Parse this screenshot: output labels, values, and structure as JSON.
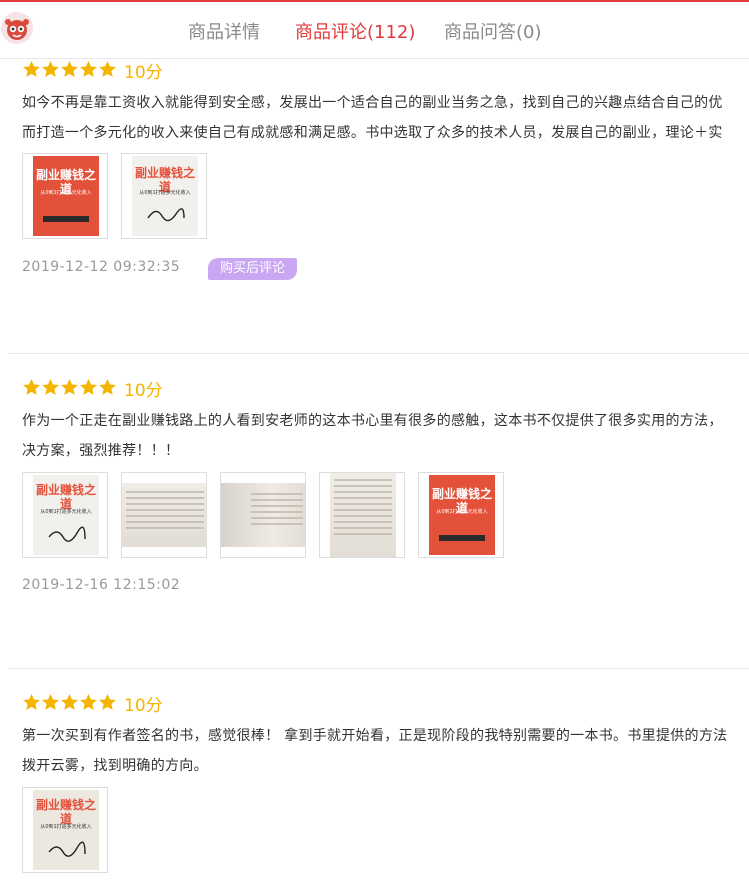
{
  "header": {
    "tabs": [
      {
        "label": "商品详情",
        "active": false
      },
      {
        "label": "商品评论(112)",
        "active": true
      },
      {
        "label": "商品问答(0)",
        "active": false
      }
    ],
    "accent_color": "#e23a3a"
  },
  "reviews": [
    {
      "rating_stars": 5,
      "score": "10分",
      "lines": [
        "如今不再是靠工资收入就能得到安全感，发展出一个适合自己的副业当务之急，找到自己的兴趣点结合自己的优",
        "而打造一个多元化的收入来使自己有成就感和满足感。书中选取了众多的技术人员，发展自己的副业，理论＋实"
      ],
      "images": [
        "book-cover-red",
        "book-cover-signed"
      ],
      "date": "2019-12-12 09:32:35",
      "badge": "购买后评论"
    },
    {
      "rating_stars": 5,
      "score": "10分",
      "lines": [
        "作为一个正走在副业赚钱路上的人看到安老师的这本书心里有很多的感触，这本书不仅提供了很多实用的方法，",
        "决方案，强烈推荐！！！"
      ],
      "images": [
        "book-cover-signed",
        "book-page-photo",
        "book-page-photo",
        "book-page-photo",
        "book-cover-red"
      ],
      "date": "2019-12-16 12:15:02",
      "badge": ""
    },
    {
      "rating_stars": 5,
      "score": "10分",
      "lines": [
        "第一次买到有作者签名的书，感觉很棒！ 拿到手就开始看，正是现阶段的我特别需要的一本书。书里提供的方法",
        "拨开云雾，找到明确的方向。"
      ],
      "images": [
        "book-cover-signed"
      ],
      "date": "",
      "badge": ""
    }
  ],
  "book_title": "副业赚钱之道",
  "book_subtitle": "从0到1打造多元化收入",
  "star_color": "#f5b400",
  "badge_color": "#c9a7f2"
}
